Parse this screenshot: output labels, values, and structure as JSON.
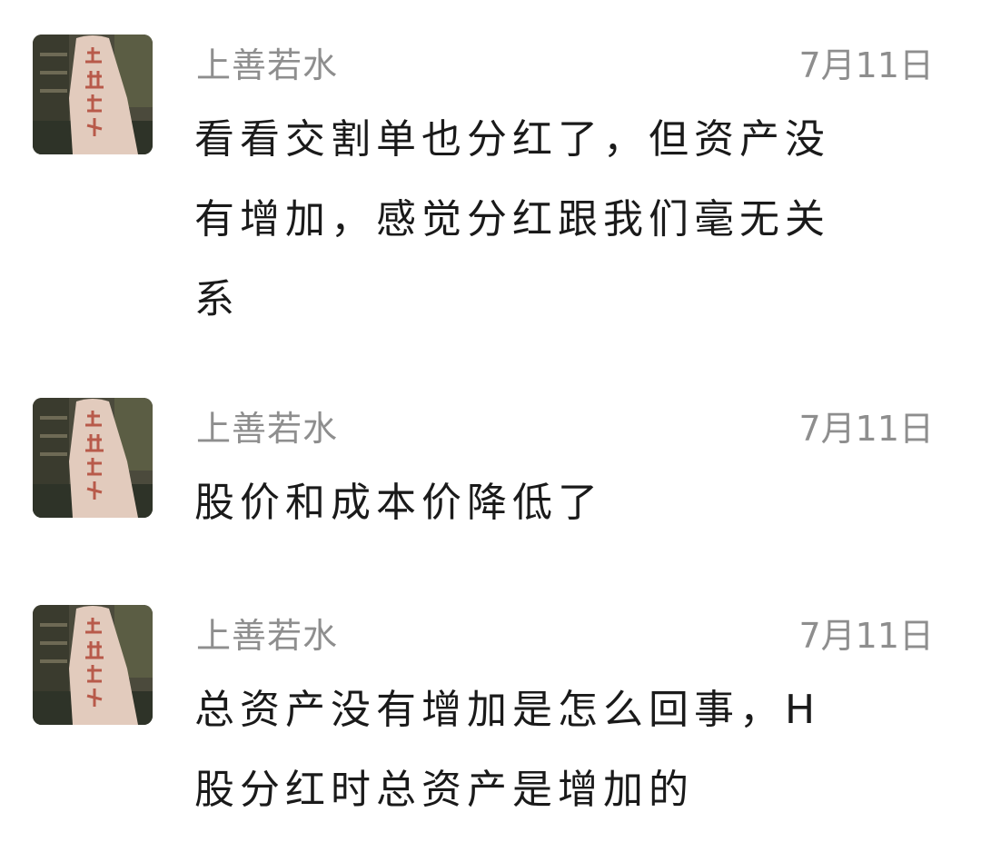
{
  "comments": [
    {
      "username": "上善若水",
      "date": "7月11日",
      "avatar": "stone-monument-avatar",
      "lines": [
        "看看交割单也分红了，但资产没",
        "有增加，感觉分红跟我们毫无关",
        "系"
      ]
    },
    {
      "username": "上善若水",
      "date": "7月11日",
      "avatar": "stone-monument-avatar",
      "lines": [
        "股价和成本价降低了"
      ]
    },
    {
      "username": "上善若水",
      "date": "7月11日",
      "avatar": "stone-monument-avatar",
      "lines": [
        "总资产没有增加是怎么回事，H",
        "股分红时总资产是增加的"
      ]
    }
  ]
}
